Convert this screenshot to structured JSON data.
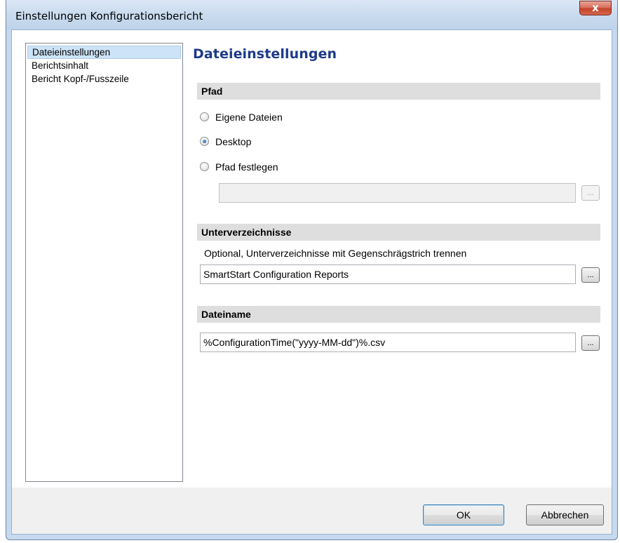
{
  "window": {
    "title": "Einstellungen Konfigurationsbericht",
    "close_glyph": "x"
  },
  "nav": {
    "items": [
      {
        "label": "Dateieinstellungen",
        "selected": true
      },
      {
        "label": "Berichtsinhalt",
        "selected": false
      },
      {
        "label": "Bericht Kopf-/Fusszeile",
        "selected": false
      }
    ]
  },
  "content": {
    "heading": "Dateieinstellungen",
    "path_section": {
      "title": "Pfad",
      "options": [
        {
          "label": "Eigene Dateien",
          "checked": false
        },
        {
          "label": "Desktop",
          "checked": true
        },
        {
          "label": "Pfad festlegen",
          "checked": false
        }
      ],
      "custom_path_value": "",
      "browse_label": "..."
    },
    "subdir_section": {
      "title": "Unterverzeichnisse",
      "hint": "Optional, Unterverzeichnisse mit Gegenschrägstrich trennen",
      "value": "SmartStart Configuration Reports",
      "browse_label": "..."
    },
    "filename_section": {
      "title": "Dateiname",
      "value": "%ConfigurationTime(\"yyyy-MM-dd\")%.csv",
      "browse_label": "..."
    }
  },
  "buttons": {
    "ok": "OK",
    "cancel": "Abbrechen"
  },
  "colors": {
    "heading": "#1e3a8a",
    "selection": "#cde3f7",
    "section_bar": "#dedede"
  },
  "icons": {
    "close": "close-icon",
    "radio": "radio-button"
  }
}
